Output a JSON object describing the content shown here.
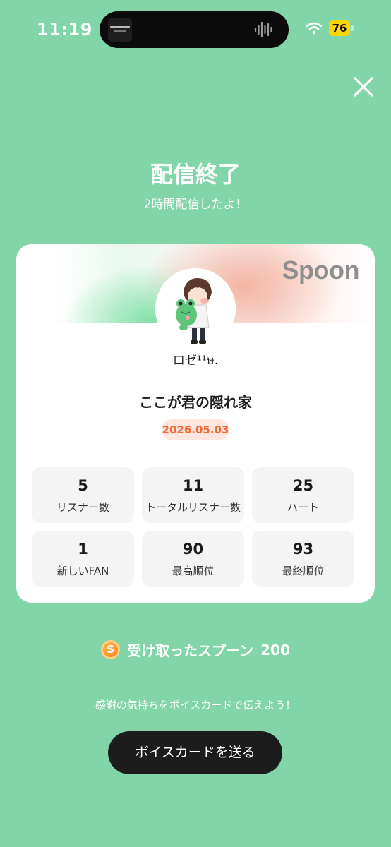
{
  "status_bar": {
    "time": "11:19",
    "battery": "76",
    "icons": [
      "wifi-icon",
      "battery-icon",
      "audio-wave-icon"
    ]
  },
  "header": {
    "title": "配信終了",
    "subtitle": "2時間配信したよ！",
    "close_icon": "close-icon"
  },
  "card": {
    "brand": "Spoon",
    "username": "ロゼ¹¹ษ.",
    "room_title": "ここが君の隠れ家",
    "date": "2026.05.03",
    "stats": [
      {
        "value": "5",
        "label": "リスナー数"
      },
      {
        "value": "11",
        "label": "トータルリスナー数"
      },
      {
        "value": "25",
        "label": "ハート"
      },
      {
        "value": "1",
        "label": "新しいFAN"
      },
      {
        "value": "90",
        "label": "最高順位"
      },
      {
        "value": "93",
        "label": "最終順位"
      }
    ]
  },
  "received": {
    "coin_letter": "S",
    "label": "受け取ったスプーン",
    "value": "200"
  },
  "thanks_text": "感謝の気持ちをボイスカードで伝えよう！",
  "voice_card_button": "ボイスカードを送る",
  "colors": {
    "background": "#81d5a8",
    "date_badge_text": "#f26a3a",
    "button_bg": "#1c1c1c",
    "battery": "#ffd60a"
  }
}
